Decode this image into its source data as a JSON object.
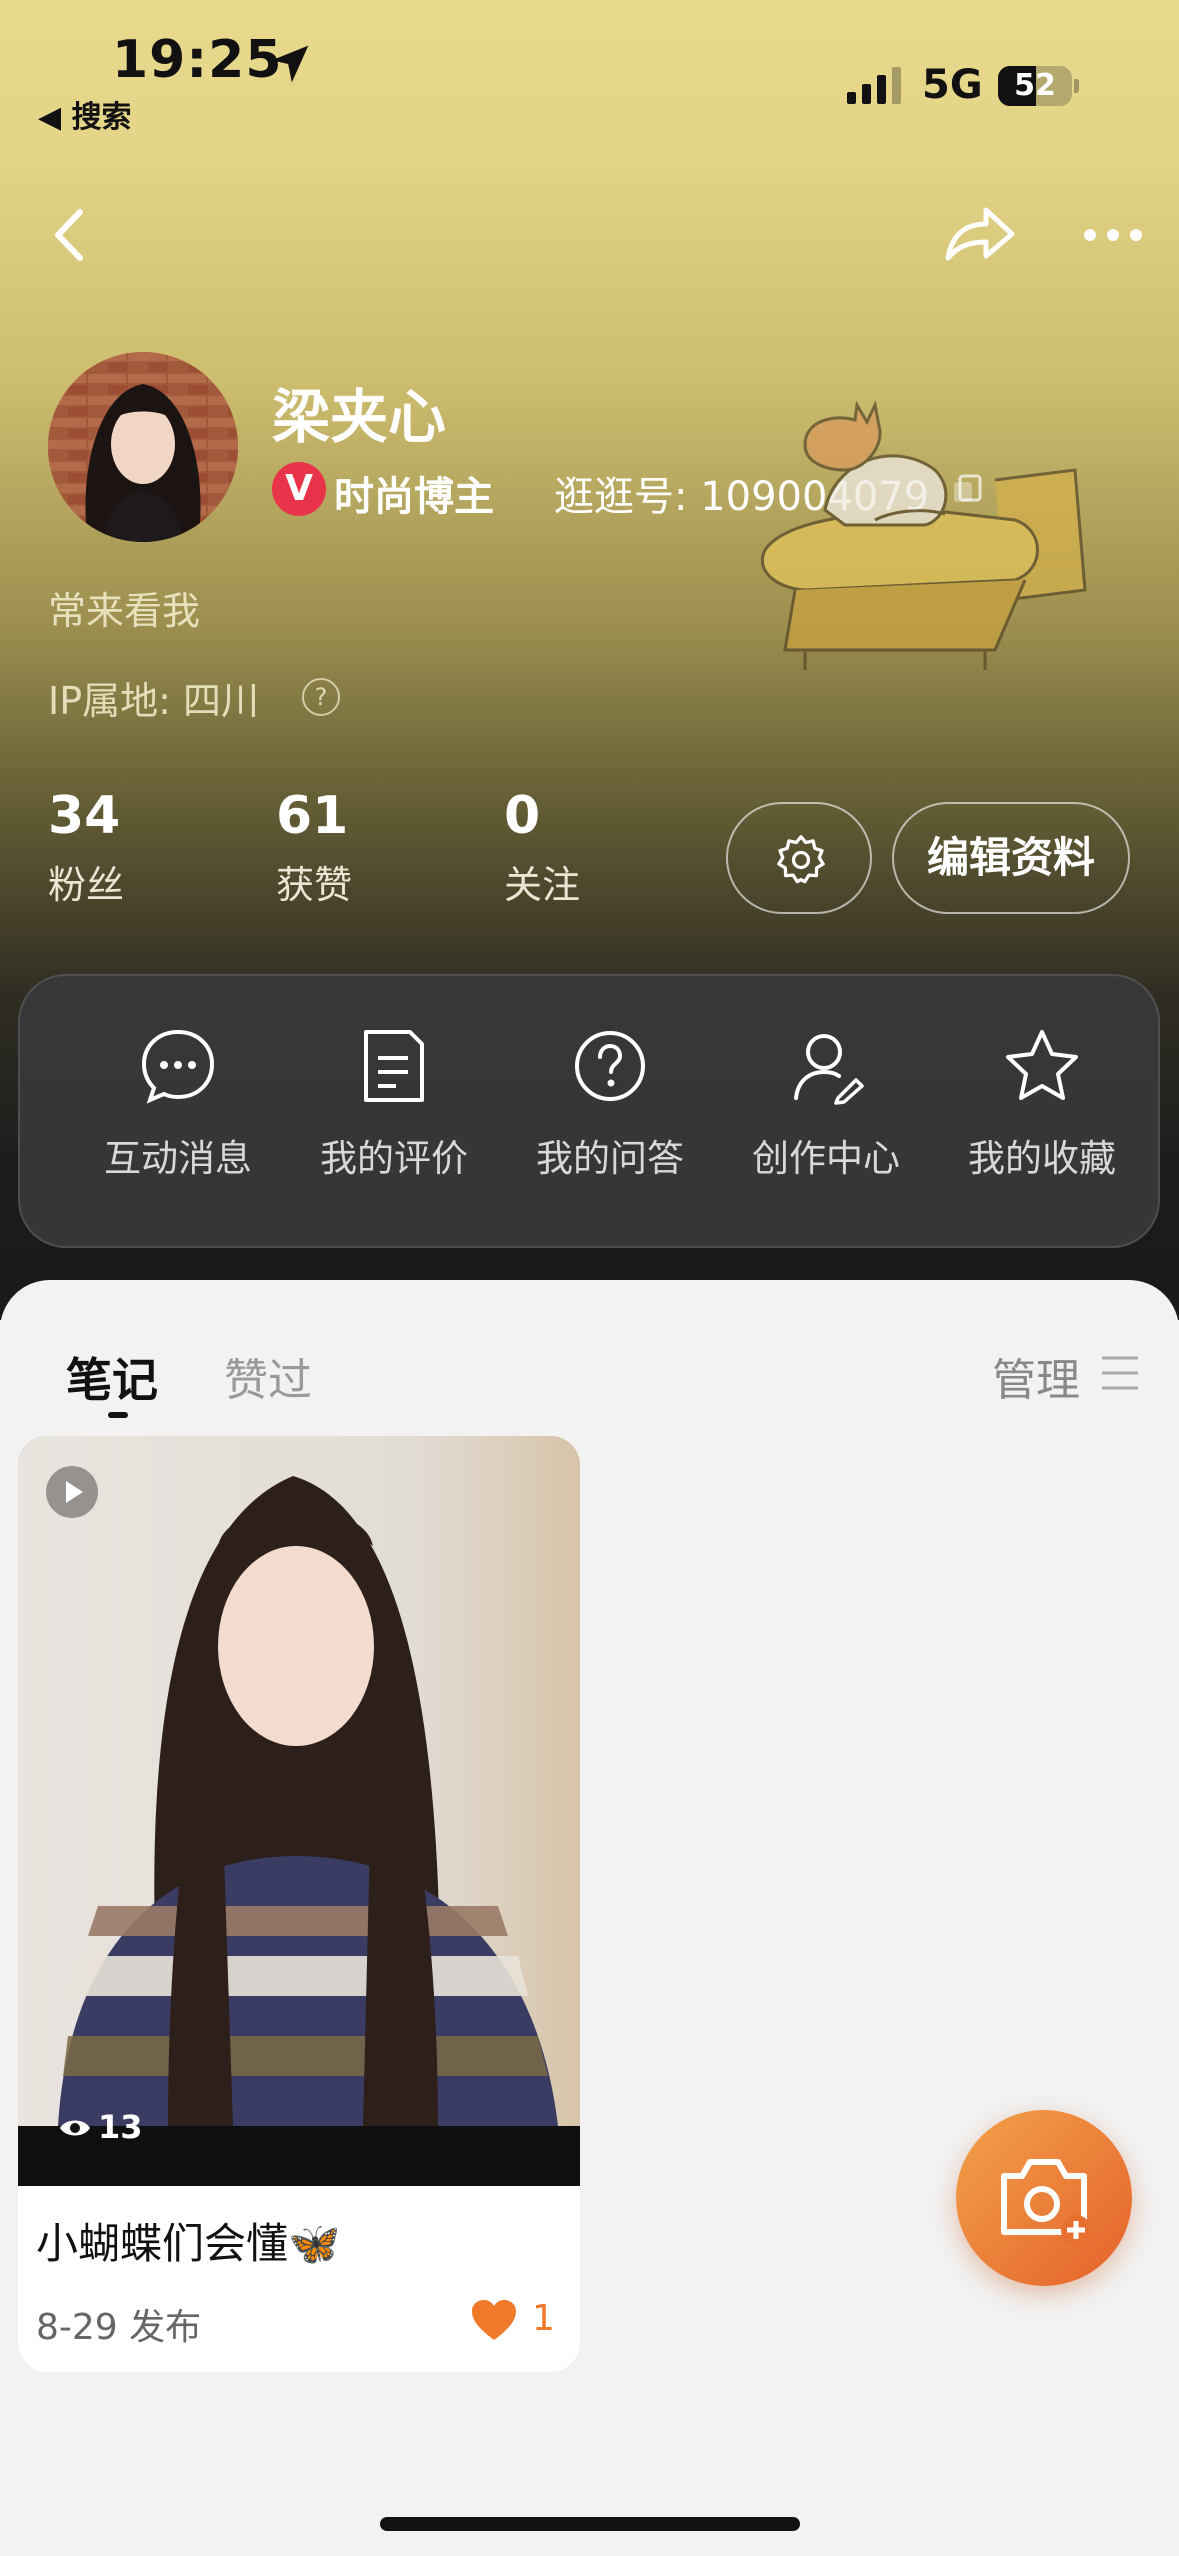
{
  "status_bar": {
    "time": "19:25",
    "back_app": "◀ 搜索",
    "network": "5G",
    "battery": "52",
    "battery_level": 0.52
  },
  "profile": {
    "name": "梁夹心",
    "badge_letter": "V",
    "role": "时尚博主",
    "uid": "逛逛号: 109004079",
    "bio": "常来看我",
    "ip": "IP属地: 四川",
    "ip_help": "?"
  },
  "stats": [
    {
      "value": "34",
      "label": "粉丝"
    },
    {
      "value": "61",
      "label": "获赞"
    },
    {
      "value": "0",
      "label": "关注"
    }
  ],
  "buttons": {
    "edit_profile": "编辑资料"
  },
  "menu": [
    {
      "label": "互动消息",
      "icon": "chat-bubble-icon"
    },
    {
      "label": "我的评价",
      "icon": "document-icon"
    },
    {
      "label": "我的问答",
      "icon": "question-icon"
    },
    {
      "label": "创作中心",
      "icon": "creator-icon"
    },
    {
      "label": "我的收藏",
      "icon": "star-icon"
    }
  ],
  "tabs": {
    "notes": "笔记",
    "liked": "赞过",
    "manage": "管理"
  },
  "notes": [
    {
      "views": "13",
      "title": "小蝴蝶们会懂🦋",
      "date": "8-29 发布",
      "likes": "1"
    }
  ],
  "colors": {
    "accent": "#f07a2a",
    "badge": "#e8344a",
    "fab_start": "#f2a24a",
    "fab_end": "#e5612a"
  }
}
